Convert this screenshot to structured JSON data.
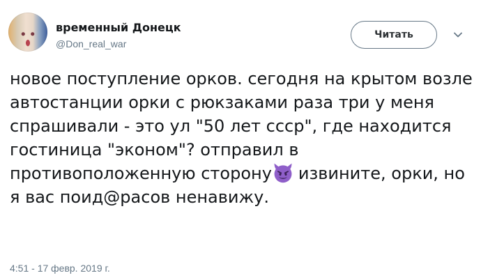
{
  "author": {
    "display_name": "временный Донецк",
    "handle": "@Don_real_war"
  },
  "follow_button": {
    "label": "Читать"
  },
  "caret_icon": "chevron-down-icon",
  "tweet": {
    "text_before_emoji": "новое поступление орков. сегодня на крытом возле автостанции орки с рюкзаками раза три у меня спрашивали - это ул \"50 лет ссср\", где находится гостиница \"эконом\"? отправил в противоположенную сторону",
    "emoji": "smiling-face-with-horns-icon",
    "text_after_emoji": "извините, орки, но я вас поид@расов ненавижу.",
    "timestamp": "4:51 - 17 февр. 2019 г."
  },
  "colors": {
    "text": "#14171a",
    "secondary": "#657786",
    "emoji_purple": "#8f5fc9"
  }
}
